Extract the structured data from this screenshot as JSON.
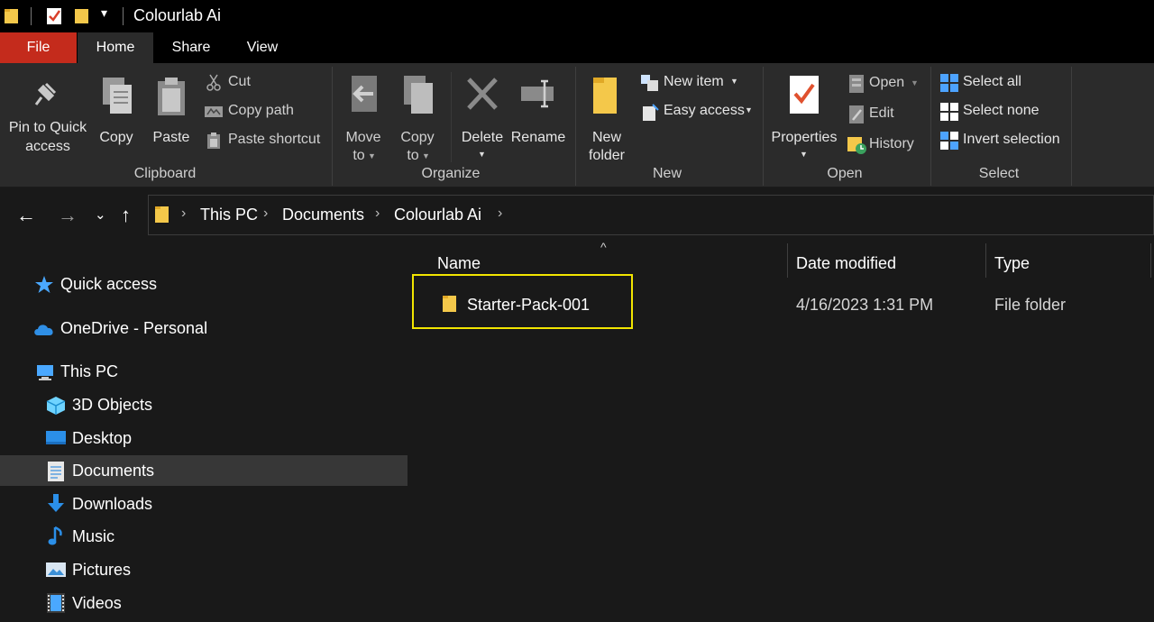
{
  "window": {
    "title": "Colourlab Ai"
  },
  "ribbon": {
    "tabs": [
      "File",
      "Home",
      "Share",
      "View"
    ],
    "clipboard": {
      "pin_label_1": "Pin to Quick",
      "pin_label_2": "access",
      "copy": "Copy",
      "paste": "Paste",
      "cut": "Cut",
      "copy_path": "Copy path",
      "paste_shortcut": "Paste shortcut",
      "group": "Clipboard"
    },
    "organize": {
      "move_to_1": "Move",
      "move_to_2": "to",
      "copy_to_1": "Copy",
      "copy_to_2": "to",
      "delete": "Delete",
      "rename": "Rename",
      "group": "Organize"
    },
    "new": {
      "new_folder_1": "New",
      "new_folder_2": "folder",
      "new_item": "New item",
      "easy_access": "Easy access",
      "group": "New"
    },
    "open": {
      "properties": "Properties",
      "open": "Open",
      "edit": "Edit",
      "history": "History",
      "group": "Open"
    },
    "select": {
      "select_all": "Select all",
      "select_none": "Select none",
      "invert_selection": "Invert selection",
      "group": "Select"
    }
  },
  "breadcrumb": [
    "This PC",
    "Documents",
    "Colourlab Ai"
  ],
  "nav": {
    "quick_access": "Quick access",
    "onedrive": "OneDrive - Personal",
    "this_pc": "This PC",
    "items": [
      "3D Objects",
      "Desktop",
      "Documents",
      "Downloads",
      "Music",
      "Pictures",
      "Videos"
    ]
  },
  "columns": {
    "name": "Name",
    "date": "Date modified",
    "type": "Type"
  },
  "files": [
    {
      "name": "Starter-Pack-001",
      "date": "4/16/2023 1:31 PM",
      "type": "File folder"
    }
  ],
  "colors": {
    "accent_file_tab": "#c42b1c",
    "highlight_box": "#f2e500",
    "folder": "#f4c84a"
  }
}
